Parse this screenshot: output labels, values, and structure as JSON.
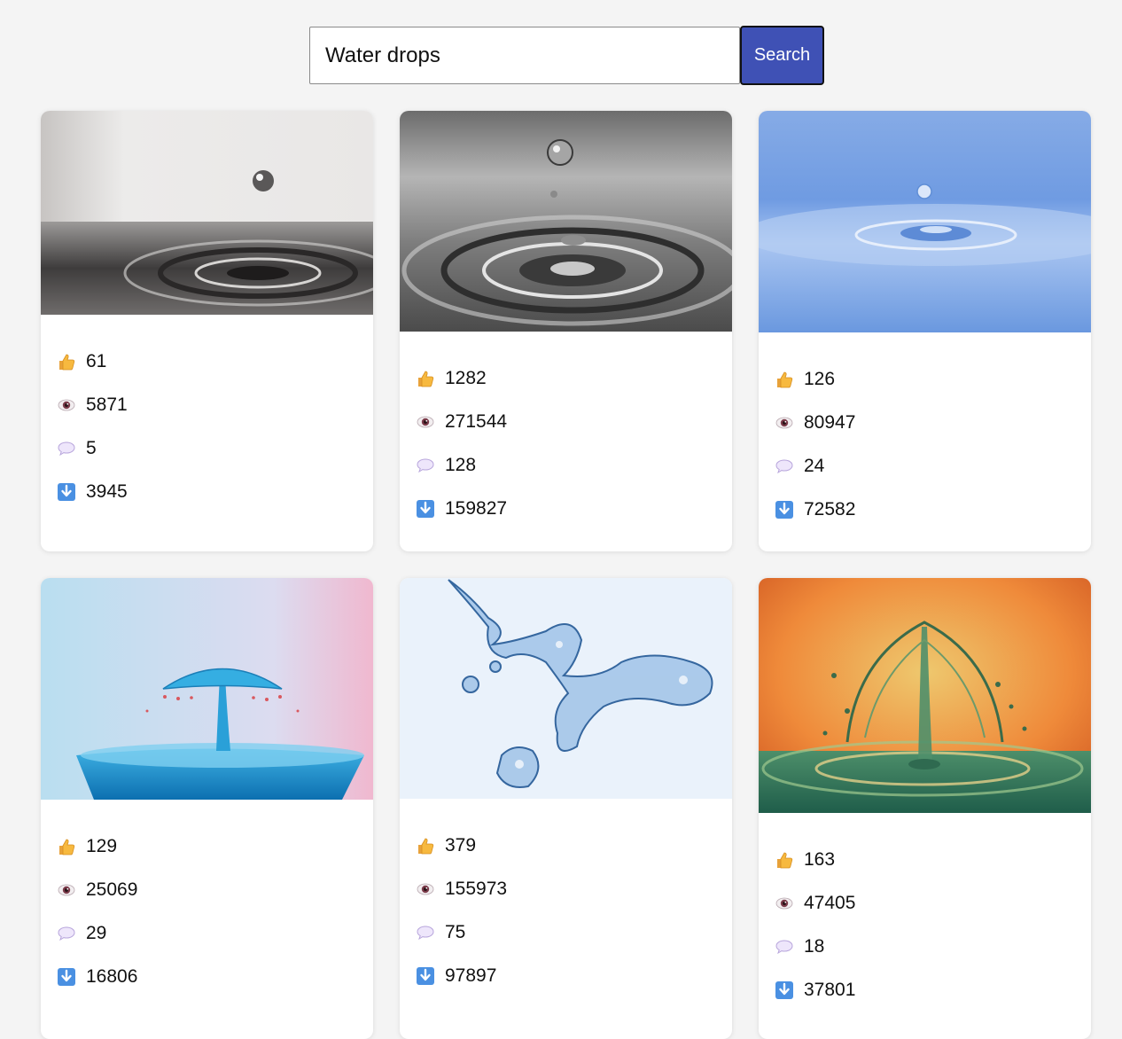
{
  "search": {
    "value": "Water drops",
    "button_label": "Search"
  },
  "icons": {
    "likes": "thumbs-up-icon",
    "views": "eye-icon",
    "comments": "speech-bubble-icon",
    "downloads": "download-arrow-icon"
  },
  "colors": {
    "accent": "#3f51b5",
    "background": "#f4f4f4"
  },
  "cards": [
    {
      "likes": "61",
      "views": "5871",
      "comments": "5",
      "downloads": "3945"
    },
    {
      "likes": "1282",
      "views": "271544",
      "comments": "128",
      "downloads": "159827"
    },
    {
      "likes": "126",
      "views": "80947",
      "comments": "24",
      "downloads": "72582"
    },
    {
      "likes": "129",
      "views": "25069",
      "comments": "29",
      "downloads": "16806"
    },
    {
      "likes": "379",
      "views": "155973",
      "comments": "75",
      "downloads": "97897"
    },
    {
      "likes": "163",
      "views": "47405",
      "comments": "18",
      "downloads": "37801"
    }
  ]
}
